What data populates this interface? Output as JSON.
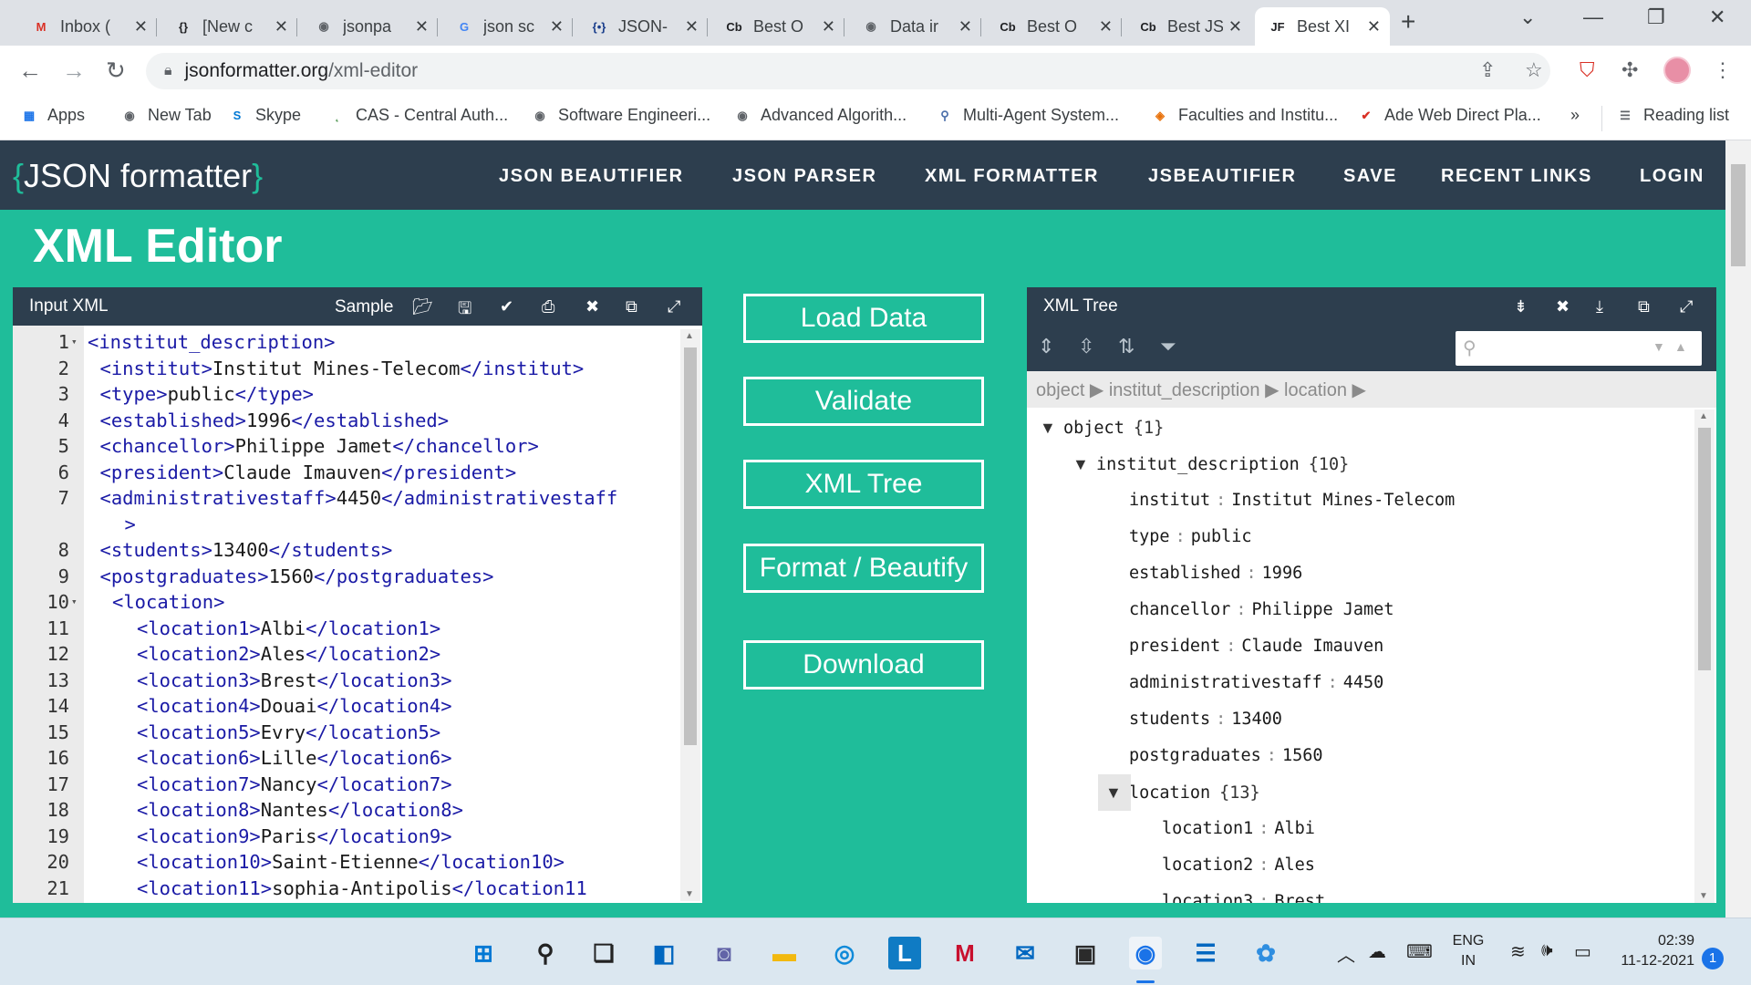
{
  "tabs": [
    {
      "title": "Inbox (",
      "favicon": "gmail-icon",
      "color": "#d93025",
      "glyph": "M"
    },
    {
      "title": "[New c",
      "favicon": "braces-icon",
      "color": "#202124",
      "glyph": "{}"
    },
    {
      "title": "jsonpa",
      "favicon": "globe-icon",
      "color": "#5f6368",
      "glyph": "◉"
    },
    {
      "title": "json sc",
      "favicon": "google-icon",
      "color": "#4285f4",
      "glyph": "G"
    },
    {
      "title": "JSON-",
      "favicon": "json-icon",
      "color": "#1a3e8c",
      "glyph": "{•}"
    },
    {
      "title": "Best O",
      "favicon": "cb-icon",
      "color": "#202124",
      "glyph": "Cb"
    },
    {
      "title": "Data ir",
      "favicon": "globe-icon",
      "color": "#5f6368",
      "glyph": "◉"
    },
    {
      "title": "Best O",
      "favicon": "cb-icon",
      "color": "#202124",
      "glyph": "Cb"
    },
    {
      "title": "Best JS",
      "favicon": "cb-icon",
      "color": "#202124",
      "glyph": "Cb"
    },
    {
      "title": "Best XI",
      "favicon": "jf-icon",
      "color": "#202124",
      "glyph": "JF",
      "active": true
    }
  ],
  "browser": {
    "url_domain": "jsonformatter.org",
    "url_path": "/xml-editor"
  },
  "bookmarks": [
    {
      "label": "Apps",
      "icon": "apps-grid-icon",
      "glyph": "▦",
      "color": "#1a73e8"
    },
    {
      "label": "New Tab",
      "icon": "globe-icon",
      "glyph": "◉",
      "color": "#5f6368"
    },
    {
      "label": "Skype",
      "icon": "skype-icon",
      "glyph": "S",
      "color": "#0078d4"
    },
    {
      "label": "CAS - Central Auth...",
      "icon": "cas-icon",
      "glyph": "˛",
      "color": "#3b8a3e"
    },
    {
      "label": "Software Engineeri...",
      "icon": "globe-icon",
      "glyph": "◉",
      "color": "#5f6368"
    },
    {
      "label": "Advanced Algorith...",
      "icon": "globe-icon",
      "glyph": "◉",
      "color": "#5f6368"
    },
    {
      "label": "Multi-Agent System...",
      "icon": "agent-icon",
      "glyph": "⚲",
      "color": "#4a6ea9"
    },
    {
      "label": "Faculties and Institu...",
      "icon": "shield-icon",
      "glyph": "◈",
      "color": "#e8710a"
    },
    {
      "label": "Ade Web Direct Pla...",
      "icon": "check-icon",
      "glyph": "✔",
      "color": "#d93025"
    }
  ],
  "reading_list": "Reading list",
  "site": {
    "logo_text": "JSON formatter",
    "nav": [
      "JSON BEAUTIFIER",
      "JSON PARSER",
      "XML FORMATTER",
      "JSBEAUTIFIER",
      "SAVE",
      "RECENT LINKS",
      "LOGIN"
    ],
    "page_title": "XML Editor",
    "brand_color": "#1fbd9a",
    "dark_color": "#2d3e4e"
  },
  "input_pane": {
    "title": "Input XML",
    "sample_label": "Sample",
    "lines": [
      {
        "n": "1",
        "fold": true,
        "indent": 0,
        "parts": [
          [
            "tag",
            "<institut_description>"
          ]
        ]
      },
      {
        "n": "2",
        "indent": 1,
        "parts": [
          [
            "tag",
            "<institut>"
          ],
          [
            "text",
            "Institut Mines-Telecom"
          ],
          [
            "tag",
            "</institut>"
          ]
        ]
      },
      {
        "n": "3",
        "indent": 1,
        "parts": [
          [
            "tag",
            "<type>"
          ],
          [
            "text",
            "public"
          ],
          [
            "tag",
            "</type>"
          ]
        ]
      },
      {
        "n": "4",
        "indent": 1,
        "parts": [
          [
            "tag",
            "<established>"
          ],
          [
            "text",
            "1996"
          ],
          [
            "tag",
            "</established>"
          ]
        ]
      },
      {
        "n": "5",
        "indent": 1,
        "parts": [
          [
            "tag",
            "<chancellor>"
          ],
          [
            "text",
            "Philippe Jamet"
          ],
          [
            "tag",
            "</chancellor>"
          ]
        ]
      },
      {
        "n": "6",
        "indent": 1,
        "parts": [
          [
            "tag",
            "<president>"
          ],
          [
            "text",
            "Claude Imauven"
          ],
          [
            "tag",
            "</president>"
          ]
        ]
      },
      {
        "n": "7",
        "indent": 1,
        "parts": [
          [
            "tag",
            "<administrativestaff>"
          ],
          [
            "text",
            "4450"
          ],
          [
            "tag",
            "</administrativestaff"
          ]
        ]
      },
      {
        "n": "",
        "indent": 3,
        "parts": [
          [
            "tag",
            ">"
          ]
        ]
      },
      {
        "n": "8",
        "indent": 1,
        "parts": [
          [
            "tag",
            "<students>"
          ],
          [
            "text",
            "13400"
          ],
          [
            "tag",
            "</students>"
          ]
        ]
      },
      {
        "n": "9",
        "indent": 1,
        "parts": [
          [
            "tag",
            "<postgraduates>"
          ],
          [
            "text",
            "1560"
          ],
          [
            "tag",
            "</postgraduates>"
          ]
        ]
      },
      {
        "n": "10",
        "fold": true,
        "indent": 2,
        "parts": [
          [
            "tag",
            "<location>"
          ]
        ]
      },
      {
        "n": "11",
        "indent": 4,
        "parts": [
          [
            "tag",
            "<location1>"
          ],
          [
            "text",
            "Albi"
          ],
          [
            "tag",
            "</location1>"
          ]
        ]
      },
      {
        "n": "12",
        "indent": 4,
        "parts": [
          [
            "tag",
            "<location2>"
          ],
          [
            "text",
            "Ales"
          ],
          [
            "tag",
            "</location2>"
          ]
        ]
      },
      {
        "n": "13",
        "indent": 4,
        "parts": [
          [
            "tag",
            "<location3>"
          ],
          [
            "text",
            "Brest"
          ],
          [
            "tag",
            "</location3>"
          ]
        ]
      },
      {
        "n": "14",
        "indent": 4,
        "parts": [
          [
            "tag",
            "<location4>"
          ],
          [
            "text",
            "Douai"
          ],
          [
            "tag",
            "</location4>"
          ]
        ]
      },
      {
        "n": "15",
        "indent": 4,
        "parts": [
          [
            "tag",
            "<location5>"
          ],
          [
            "text",
            "Evry"
          ],
          [
            "tag",
            "</location5>"
          ]
        ]
      },
      {
        "n": "16",
        "indent": 4,
        "parts": [
          [
            "tag",
            "<location6>"
          ],
          [
            "text",
            "Lille"
          ],
          [
            "tag",
            "</location6>"
          ]
        ]
      },
      {
        "n": "17",
        "indent": 4,
        "parts": [
          [
            "tag",
            "<location7>"
          ],
          [
            "text",
            "Nancy"
          ],
          [
            "tag",
            "</location7>"
          ]
        ]
      },
      {
        "n": "18",
        "indent": 4,
        "parts": [
          [
            "tag",
            "<location8>"
          ],
          [
            "text",
            "Nantes"
          ],
          [
            "tag",
            "</location8>"
          ]
        ]
      },
      {
        "n": "19",
        "indent": 4,
        "parts": [
          [
            "tag",
            "<location9>"
          ],
          [
            "text",
            "Paris"
          ],
          [
            "tag",
            "</location9>"
          ]
        ]
      },
      {
        "n": "20",
        "indent": 4,
        "parts": [
          [
            "tag",
            "<location10>"
          ],
          [
            "text",
            "Saint-Etienne"
          ],
          [
            "tag",
            "</location10>"
          ]
        ]
      },
      {
        "n": "21",
        "indent": 4,
        "parts": [
          [
            "tag",
            "<location11>"
          ],
          [
            "text",
            "sophia-Antipolis"
          ],
          [
            "tag",
            "</location11"
          ]
        ]
      }
    ]
  },
  "actions": {
    "load": "Load Data",
    "validate": "Validate",
    "tree": "XML Tree",
    "format": "Format / Beautify",
    "download": "Download"
  },
  "tree_pane": {
    "title": "XML Tree",
    "breadcrumb": "object ▶ institut_description ▶ location ▶",
    "rows": [
      {
        "level": 0,
        "toggle": "▼",
        "key": "object",
        "count": "{1}"
      },
      {
        "level": 1,
        "toggle": "▼",
        "key": "institut_description",
        "count": "{10}"
      },
      {
        "level": 2,
        "key": "institut",
        "value": "Institut Mines-Telecom"
      },
      {
        "level": 2,
        "key": "type",
        "value": "public"
      },
      {
        "level": 2,
        "key": "established",
        "value": "1996"
      },
      {
        "level": 2,
        "key": "chancellor",
        "value": "Philippe Jamet"
      },
      {
        "level": 2,
        "key": "president",
        "value": "Claude Imauven"
      },
      {
        "level": 2,
        "key": "administrativestaff",
        "value": "4450"
      },
      {
        "level": 2,
        "key": "students",
        "value": "13400"
      },
      {
        "level": 2,
        "key": "postgraduates",
        "value": "1560"
      },
      {
        "level": 2,
        "toggle": "▼",
        "key": "location",
        "count": "{13}",
        "boxed": true
      },
      {
        "level": 3,
        "key": "location1",
        "value": "Albi"
      },
      {
        "level": 3,
        "key": "location2",
        "value": "Ales"
      },
      {
        "level": 3,
        "key": "location3",
        "value": "Brest"
      }
    ]
  },
  "taskbar": {
    "lang_top": "ENG",
    "lang_bottom": "IN",
    "time": "02:39",
    "date": "11-12-2021",
    "notifications": "1"
  }
}
